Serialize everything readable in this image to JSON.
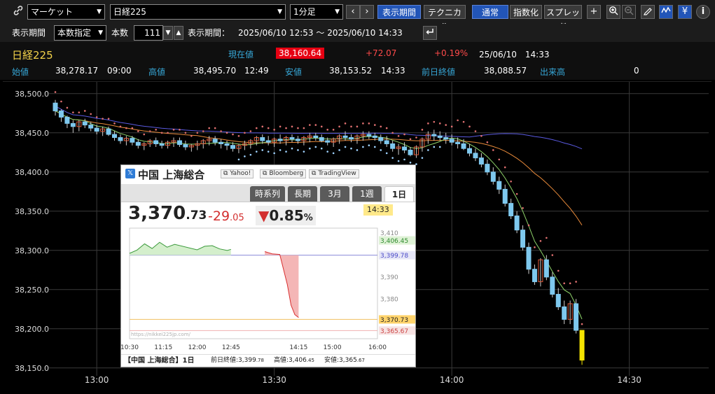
{
  "toolbar": {
    "market_select": "マーケット",
    "symbol_select": "日経225",
    "interval_select": "1分足",
    "btn_display_period": "表示期間",
    "btn_technical": "テクニカル",
    "btn_normal": "通常",
    "btn_index": "指数化",
    "btn_spread": "スプレッド",
    "icon_plus": "+",
    "icon_yen": "¥",
    "icon_info": "i"
  },
  "period_bar": {
    "label_period": "表示期間",
    "period_mode": "本数指定",
    "label_count": "本数",
    "count_value": "111",
    "label_range": "表示期間：",
    "range_value": "2025/06/10 12:53 ～ 2025/06/10 14:33"
  },
  "quote": {
    "name": "日経225",
    "label_current": "現在値",
    "current": "38,160.64",
    "change": "+72.07",
    "change_pct": "+0.19%",
    "datetime": "25/06/10　14:33",
    "label_open": "始値",
    "open": "38,278.17",
    "open_time": "09:00",
    "label_high": "高値",
    "high": "38,495.70",
    "high_time": "12:49",
    "label_low": "安値",
    "low": "38,153.52",
    "low_time": "14:33",
    "label_prev": "前日終値",
    "prev": "38,088.57",
    "label_volume": "出来高",
    "volume": "0"
  },
  "chart_data": [
    {
      "type": "candlestick",
      "y_ticks": [
        "38,500.0",
        "38,450.0",
        "38,400.0",
        "38,350.0",
        "38,300.0",
        "38,250.0",
        "38,200.0",
        "38,150.0"
      ],
      "x_ticks": [
        "13:00",
        "13:30",
        "14:00",
        "14:30"
      ],
      "ylim": [
        38140,
        38515
      ],
      "grid": true,
      "x_time_range": [
        "12:53",
        "14:33"
      ],
      "candles": [
        [
          38488,
          38492,
          38472,
          38478
        ],
        [
          38478,
          38480,
          38464,
          38470
        ],
        [
          38470,
          38472,
          38456,
          38462
        ],
        [
          38462,
          38466,
          38450,
          38458
        ],
        [
          38458,
          38466,
          38452,
          38464
        ],
        [
          38464,
          38468,
          38456,
          38460
        ],
        [
          38460,
          38464,
          38452,
          38456
        ],
        [
          38456,
          38460,
          38448,
          38452
        ],
        [
          38452,
          38458,
          38446,
          38455
        ],
        [
          38455,
          38458,
          38446,
          38448
        ],
        [
          38448,
          38452,
          38440,
          38444
        ],
        [
          38444,
          38448,
          38436,
          38440
        ],
        [
          38440,
          38446,
          38434,
          38443
        ],
        [
          38443,
          38446,
          38434,
          38438
        ],
        [
          38438,
          38442,
          38430,
          38434
        ],
        [
          38434,
          38438,
          38428,
          38436
        ],
        [
          38436,
          38442,
          38432,
          38440
        ],
        [
          38440,
          38444,
          38432,
          38436
        ],
        [
          38436,
          38440,
          38430,
          38434
        ],
        [
          38434,
          38440,
          38430,
          38438
        ],
        [
          38438,
          38444,
          38432,
          38440
        ],
        [
          38440,
          38444,
          38432,
          38435
        ],
        [
          38435,
          38440,
          38428,
          38432
        ],
        [
          38432,
          38436,
          38426,
          38434
        ],
        [
          38434,
          38440,
          38428,
          38436
        ],
        [
          38436,
          38442,
          38430,
          38440
        ],
        [
          38440,
          38446,
          38434,
          38442
        ],
        [
          38442,
          38446,
          38434,
          38438
        ],
        [
          38438,
          38442,
          38430,
          38436
        ],
        [
          38436,
          38440,
          38428,
          38434
        ],
        [
          38434,
          38438,
          38426,
          38430
        ],
        [
          38430,
          38436,
          38424,
          38434
        ],
        [
          38434,
          38440,
          38428,
          38436
        ],
        [
          38436,
          38442,
          38430,
          38440
        ],
        [
          38440,
          38446,
          38434,
          38444
        ],
        [
          38444,
          38448,
          38436,
          38440
        ],
        [
          38440,
          38446,
          38434,
          38438
        ],
        [
          38438,
          38444,
          38432,
          38442
        ],
        [
          38442,
          38448,
          38436,
          38440
        ],
        [
          38440,
          38446,
          38434,
          38444
        ],
        [
          38444,
          38448,
          38438,
          38442
        ],
        [
          38442,
          38446,
          38436,
          38440
        ],
        [
          38440,
          38446,
          38434,
          38444
        ],
        [
          38444,
          38450,
          38438,
          38446
        ],
        [
          38446,
          38450,
          38440,
          38444
        ],
        [
          38444,
          38448,
          38438,
          38440
        ],
        [
          38440,
          38444,
          38434,
          38438
        ],
        [
          38438,
          38444,
          38432,
          38442
        ],
        [
          38442,
          38448,
          38436,
          38446
        ],
        [
          38446,
          38452,
          38440,
          38444
        ],
        [
          38444,
          38448,
          38438,
          38442
        ],
        [
          38442,
          38448,
          38436,
          38446
        ],
        [
          38446,
          38452,
          38440,
          38448
        ],
        [
          38448,
          38452,
          38442,
          38446
        ],
        [
          38446,
          38450,
          38440,
          38444
        ],
        [
          38444,
          38448,
          38436,
          38440
        ],
        [
          38440,
          38446,
          38432,
          38436
        ],
        [
          38436,
          38440,
          38426,
          38430
        ],
        [
          38430,
          38436,
          38422,
          38432
        ],
        [
          38432,
          38438,
          38424,
          38428
        ],
        [
          38428,
          38432,
          38420,
          38422
        ],
        [
          38422,
          38434,
          38418,
          38432
        ],
        [
          38432,
          38444,
          38426,
          38442
        ],
        [
          38442,
          38452,
          38436,
          38448
        ],
        [
          38448,
          38454,
          38440,
          38446
        ],
        [
          38446,
          38452,
          38440,
          38444
        ],
        [
          38444,
          38450,
          38436,
          38442
        ],
        [
          38442,
          38448,
          38434,
          38438
        ],
        [
          38438,
          38444,
          38430,
          38436
        ],
        [
          38436,
          38442,
          38428,
          38430
        ],
        [
          38430,
          38436,
          38420,
          38424
        ],
        [
          38424,
          38430,
          38414,
          38418
        ],
        [
          38418,
          38424,
          38406,
          38410
        ],
        [
          38410,
          38416,
          38396,
          38400
        ],
        [
          38400,
          38406,
          38384,
          38388
        ],
        [
          38388,
          38394,
          38372,
          38378
        ],
        [
          38378,
          38384,
          38356,
          38360
        ],
        [
          38360,
          38366,
          38340,
          38344
        ],
        [
          38344,
          38350,
          38322,
          38326
        ],
        [
          38326,
          38332,
          38300,
          38304
        ],
        [
          38304,
          38310,
          38270,
          38276
        ],
        [
          38276,
          38282,
          38256,
          38260
        ],
        [
          38260,
          38290,
          38254,
          38288
        ],
        [
          38288,
          38294,
          38262,
          38266
        ],
        [
          38266,
          38272,
          38240,
          38244
        ],
        [
          38244,
          38252,
          38224,
          38228
        ],
        [
          38228,
          38236,
          38206,
          38212
        ],
        [
          38212,
          38236,
          38206,
          38232
        ],
        [
          38232,
          38238,
          38194,
          38198
        ],
        [
          38198,
          38184,
          38154,
          38160
        ]
      ],
      "ma_short_label": "",
      "ma_long_label": "",
      "ma_mid_label": ""
    },
    {
      "type": "line",
      "title": "中国 上海総合",
      "x_ticks": [
        "10:30",
        "11:15",
        "12:00",
        "12:45",
        "14:15",
        "15:00",
        "16:00"
      ],
      "y_ticks": [
        "3,410",
        "3,406.45",
        "3,399.78",
        "3,390",
        "3,380",
        "3,370.73",
        "3,365.67"
      ],
      "ylim": [
        3362,
        3412
      ],
      "prev_close": 3399.78,
      "series": [
        {
          "x": [
            "10:30",
            "10:40",
            "10:50",
            "11:00",
            "11:10",
            "11:20",
            "11:30",
            "12:00",
            "12:10",
            "12:20",
            "12:30",
            "12:40",
            "12:45",
            "13:30",
            "13:40",
            "13:50",
            "14:00",
            "14:05",
            "14:10",
            "14:15"
          ],
          "y": [
            3400.6,
            3402.1,
            3404.9,
            3402.8,
            3405.6,
            3403.4,
            3404.7,
            3402.2,
            3403.8,
            3404.1,
            3402.6,
            3401.9,
            3402.4,
            3401.4,
            3400.4,
            3400.1,
            3386.5,
            3377.2,
            3372.9,
            3371.6
          ]
        }
      ]
    }
  ],
  "overlay": {
    "x_icon": "𝕏",
    "title": "中国 上海総合",
    "link_yahoo": "Yahoo!",
    "link_bloomberg": "Bloomberg",
    "link_tradingview": "TradingView",
    "tabs": [
      "時系列",
      "長期",
      "3月",
      "1週",
      "1日"
    ],
    "active_tab": "1日",
    "price_int": "3,370",
    "price_dec": ".73",
    "change_int": "-29",
    "change_dec": ".05",
    "pct_tri": "▼",
    "pct_int": "0.85",
    "pct_sign": "%",
    "time_badge": "14:33",
    "watermark": "https://nikkei225jp.com/",
    "footer_title": "【中国 上海総合】1日",
    "footer_prev": "前日終値:3,399",
    "footer_prev_dec": ".78",
    "footer_high": "高値:3,406",
    "footer_high_dec": ".45",
    "footer_low": "安値:3,365",
    "footer_low_dec": ".67"
  }
}
